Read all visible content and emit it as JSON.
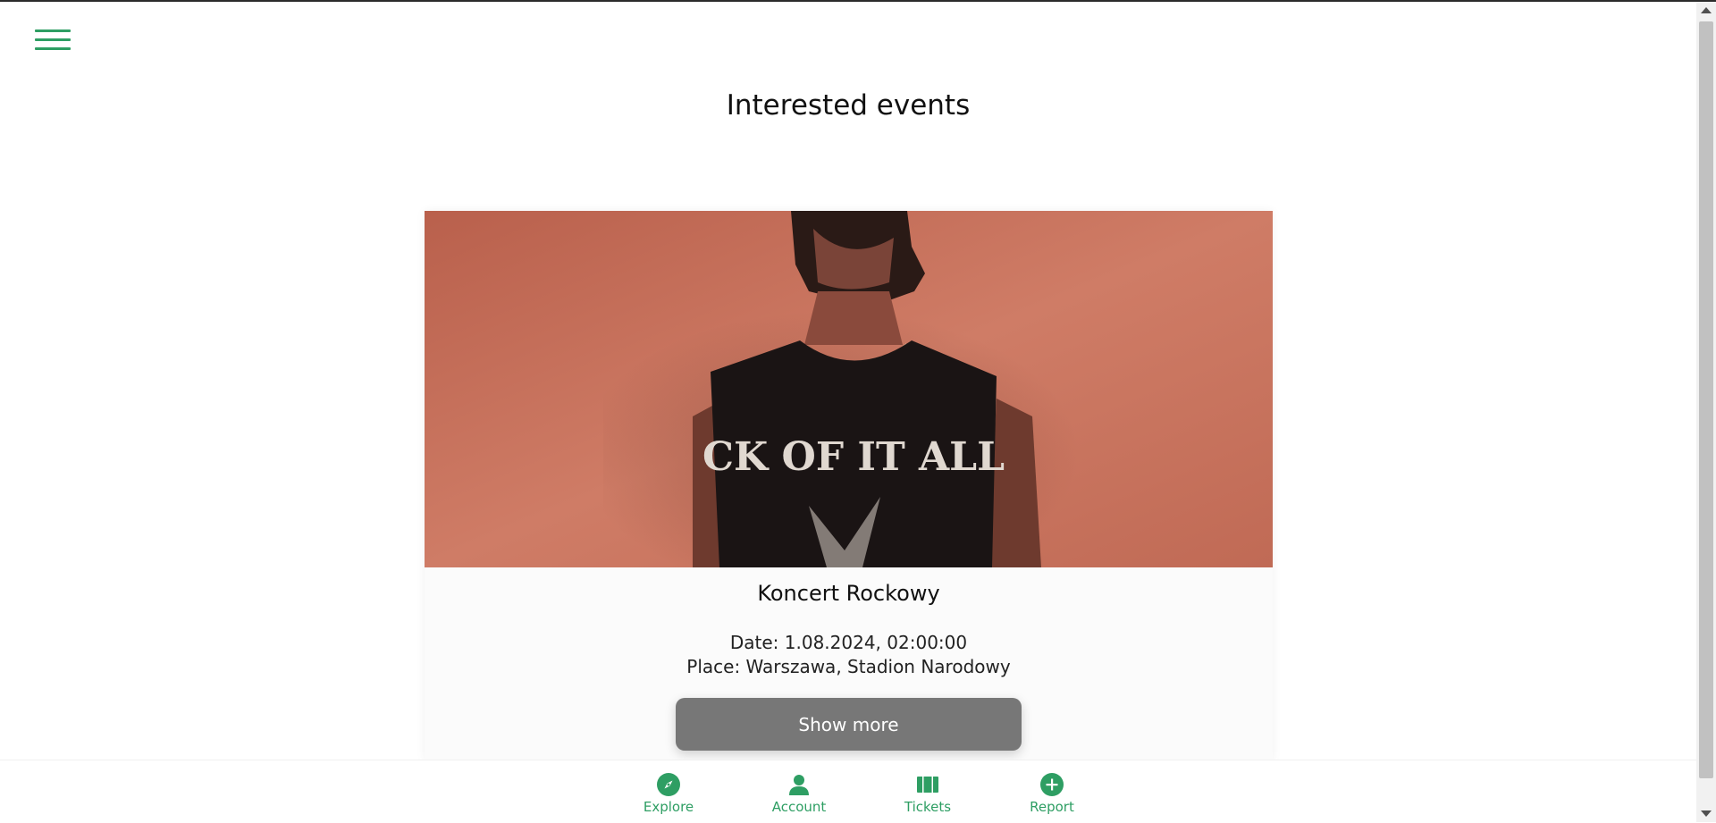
{
  "page": {
    "title": "Interested events"
  },
  "header": {
    "menu_icon": "hamburger-icon"
  },
  "event": {
    "name": "Koncert Rockowy",
    "date": "Date: 1.08.2024, 02:00:00",
    "place": "Place: Warszawa, Stadion Narodowy",
    "shirt_text": "CK OF IT ALL",
    "show_more_label": "Show more"
  },
  "bottom_nav": {
    "items": [
      {
        "label": "Explore",
        "icon": "compass-icon"
      },
      {
        "label": "Account",
        "icon": "person-icon"
      },
      {
        "label": "Tickets",
        "icon": "ticket-icon"
      },
      {
        "label": "Report",
        "icon": "plus-circle-icon"
      }
    ]
  },
  "colors": {
    "accent": "#2e9e63",
    "button_bg": "#777777",
    "photo_bg": "#c9705a"
  }
}
